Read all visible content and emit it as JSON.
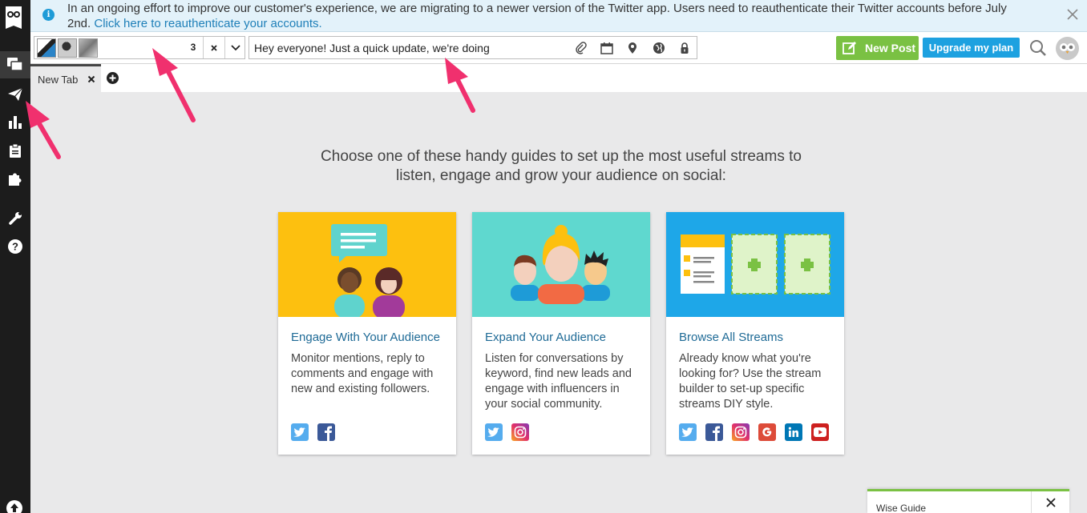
{
  "banner": {
    "text": "In an ongoing effort to improve our customer's experience, we are migrating to a newer version of the Twitter app. Users need to reauthenticate their Twitter accounts before July 2nd.",
    "link": "Click here to reauthenticate your accounts."
  },
  "toolbar": {
    "profile_count": "3",
    "composer_text": "Hey everyone! Just a quick update, we're doing",
    "new_post_label": "New Post",
    "upgrade_label": "Upgrade my plan"
  },
  "tabs": [
    {
      "label": "New Tab"
    }
  ],
  "intro": {
    "line1": "Choose one of these handy guides to set up the most useful streams to",
    "line2": "listen, engage and grow your audience on social:"
  },
  "cards": [
    {
      "title": "Engage With Your Audience",
      "desc": "Monitor mentions, reply to comments and engage with new and existing followers.",
      "networks": [
        "twitter-icon",
        "facebook-icon"
      ]
    },
    {
      "title": "Expand Your Audience",
      "desc": "Listen for conversations by keyword, find new leads and engage with influencers in your social community.",
      "networks": [
        "twitter-icon",
        "instagram-icon"
      ]
    },
    {
      "title": "Browse All Streams",
      "desc": "Already know what you're looking for? Use the stream builder to set-up specific streams DIY style.",
      "networks": [
        "twitter-icon",
        "facebook-icon",
        "instagram-icon",
        "google-icon",
        "linkedin-icon",
        "youtube-icon"
      ]
    }
  ],
  "wise_guide": {
    "label": "Wise Guide"
  },
  "colors": {
    "sidebar": "#1c1c1c",
    "accent_green": "#7ac143",
    "accent_blue": "#1da1e0",
    "link": "#1e6a96",
    "annotation_arrow": "#f0306e"
  },
  "sidebar_icons": [
    "owl-logo-icon",
    "streams-icon",
    "publisher-icon",
    "analytics-icon",
    "assignments-icon",
    "apps-icon",
    "tools-icon",
    "help-icon",
    "upload-icon"
  ]
}
